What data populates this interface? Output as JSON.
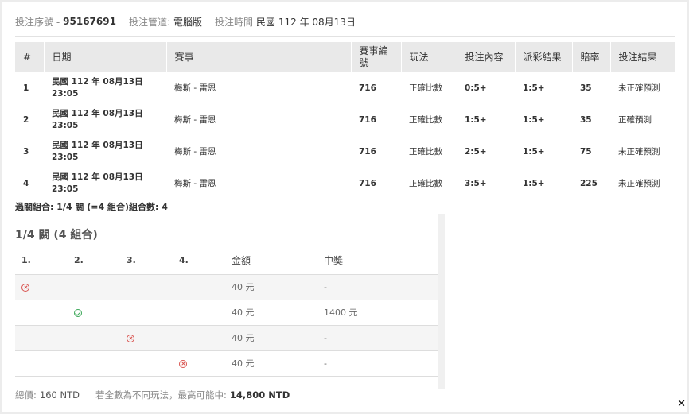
{
  "header": {
    "serial_label": "投注序號 -",
    "serial_value": "95167691",
    "channel_label": "投注管道:",
    "channel_value": "電腦版",
    "time_label": "投注時間",
    "time_value": "民國 112 年 08月13日"
  },
  "bets_table": {
    "columns": [
      "#",
      "日期",
      "賽事",
      "賽事編號",
      "玩法",
      "投注內容",
      "派彩結果",
      "賠率",
      "投注結果"
    ],
    "rows": [
      {
        "no": "1",
        "date": "民國 112 年 08月13日",
        "time": "23:05",
        "match": "梅斯 - 雷恩",
        "match_no": "716",
        "play": "正確比數",
        "content": "0:5+",
        "payout": "1:5+",
        "odds": "35",
        "result": "未正確預測"
      },
      {
        "no": "2",
        "date": "民國 112 年 08月13日",
        "time": "23:05",
        "match": "梅斯 - 雷恩",
        "match_no": "716",
        "play": "正確比數",
        "content": "1:5+",
        "payout": "1:5+",
        "odds": "35",
        "result": "正確預測"
      },
      {
        "no": "3",
        "date": "民國 112 年 08月13日",
        "time": "23:05",
        "match": "梅斯 - 雷恩",
        "match_no": "716",
        "play": "正確比數",
        "content": "2:5+",
        "payout": "1:5+",
        "odds": "75",
        "result": "未正確預測"
      },
      {
        "no": "4",
        "date": "民國 112 年 08月13日",
        "time": "23:05",
        "match": "梅斯 - 雷恩",
        "match_no": "716",
        "play": "正確比數",
        "content": "3:5+",
        "payout": "1:5+",
        "odds": "225",
        "result": "未正確預測"
      }
    ]
  },
  "combo_summary": "過關組合: 1/4 關 (=4 組合)組合數: 4",
  "combo": {
    "title": "1/4 關 (4 組合)",
    "columns": [
      "1.",
      "2.",
      "3.",
      "4.",
      "金額",
      "中獎"
    ],
    "rows": [
      {
        "amount": "40 元",
        "prize": "-",
        "icon_col": 1,
        "icon": "cross-circle-icon"
      },
      {
        "amount": "40 元",
        "prize": "1400 元",
        "icon_col": 2,
        "icon": "check-circle-icon"
      },
      {
        "amount": "40 元",
        "prize": "-",
        "icon_col": 3,
        "icon": "cross-circle-icon"
      },
      {
        "amount": "40 元",
        "prize": "-",
        "icon_col": 4,
        "icon": "cross-circle-icon"
      }
    ]
  },
  "footer": {
    "total_label": "總價:",
    "total_value": "160 NTD",
    "max_label": "若全數為不同玩法，最高可能中:",
    "max_value": "14,800 NTD"
  },
  "close_glyph": "✕",
  "colors": {
    "loss": "#d9534f",
    "win": "#3aa757",
    "header_bg": "#e9e9e9"
  }
}
